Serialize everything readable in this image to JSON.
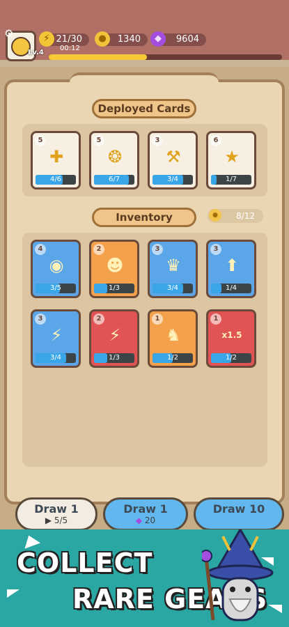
{
  "status": {
    "level": "Lv.4",
    "energy": "21/30",
    "timer": "00:12",
    "gold": "1340",
    "gems": "9604",
    "xp_fraction": 0.42
  },
  "deployed": {
    "title": "Deployed Cards",
    "cards": [
      {
        "level": "5",
        "progress": "4/6",
        "fill": 0.67,
        "icon": "shield-plus-icon",
        "theme": "neutral",
        "glyph": "✚"
      },
      {
        "level": "5",
        "progress": "6/7",
        "fill": 0.86,
        "icon": "medal-icon",
        "theme": "neutral",
        "glyph": "❂"
      },
      {
        "level": "3",
        "progress": "3/4",
        "fill": 0.75,
        "icon": "anvil-hammer-icon",
        "theme": "neutral",
        "glyph": "⚒"
      },
      {
        "level": "6",
        "progress": "1/7",
        "fill": 0.14,
        "icon": "golden-emblem-icon",
        "theme": "neutral",
        "glyph": "★"
      }
    ]
  },
  "inventory": {
    "title": "Inventory",
    "capacity": "8/12",
    "cards": [
      {
        "level": "4",
        "progress": "3/5",
        "fill": 0.6,
        "icon": "sack-icon",
        "theme": "blue",
        "glyph": "◉"
      },
      {
        "level": "2",
        "progress": "1/3",
        "fill": 0.33,
        "icon": "tiger-icon",
        "theme": "orange",
        "glyph": "☻"
      },
      {
        "level": "3",
        "progress": "3/4",
        "fill": 0.75,
        "icon": "golden-statue-icon",
        "theme": "blue",
        "glyph": "♛"
      },
      {
        "level": "3",
        "progress": "1/4",
        "fill": 0.25,
        "icon": "magic-pedestal-icon",
        "theme": "blue",
        "glyph": "⬆"
      },
      {
        "level": "3",
        "progress": "3/4",
        "fill": 0.75,
        "icon": "chain-lightning-icon",
        "theme": "blue",
        "glyph": "⚡"
      },
      {
        "level": "2",
        "progress": "1/3",
        "fill": 0.33,
        "icon": "lightning-icon",
        "theme": "red",
        "glyph": "⚡"
      },
      {
        "level": "1",
        "progress": "1/2",
        "fill": 0.5,
        "icon": "dino-icon",
        "theme": "orange",
        "glyph": "♞"
      },
      {
        "level": "1",
        "progress": "1/2",
        "fill": 0.5,
        "icon": "speed-x15-icon",
        "theme": "red",
        "glyph": "x1.5"
      }
    ]
  },
  "draw": {
    "single_free": {
      "label": "Draw 1",
      "cost": "5/5"
    },
    "single_gem": {
      "label": "Draw 1",
      "cost": "20"
    },
    "ten": {
      "label": "Draw 10"
    }
  },
  "promo": {
    "line1": "COLLECT",
    "line2": "RARE GEARS"
  }
}
